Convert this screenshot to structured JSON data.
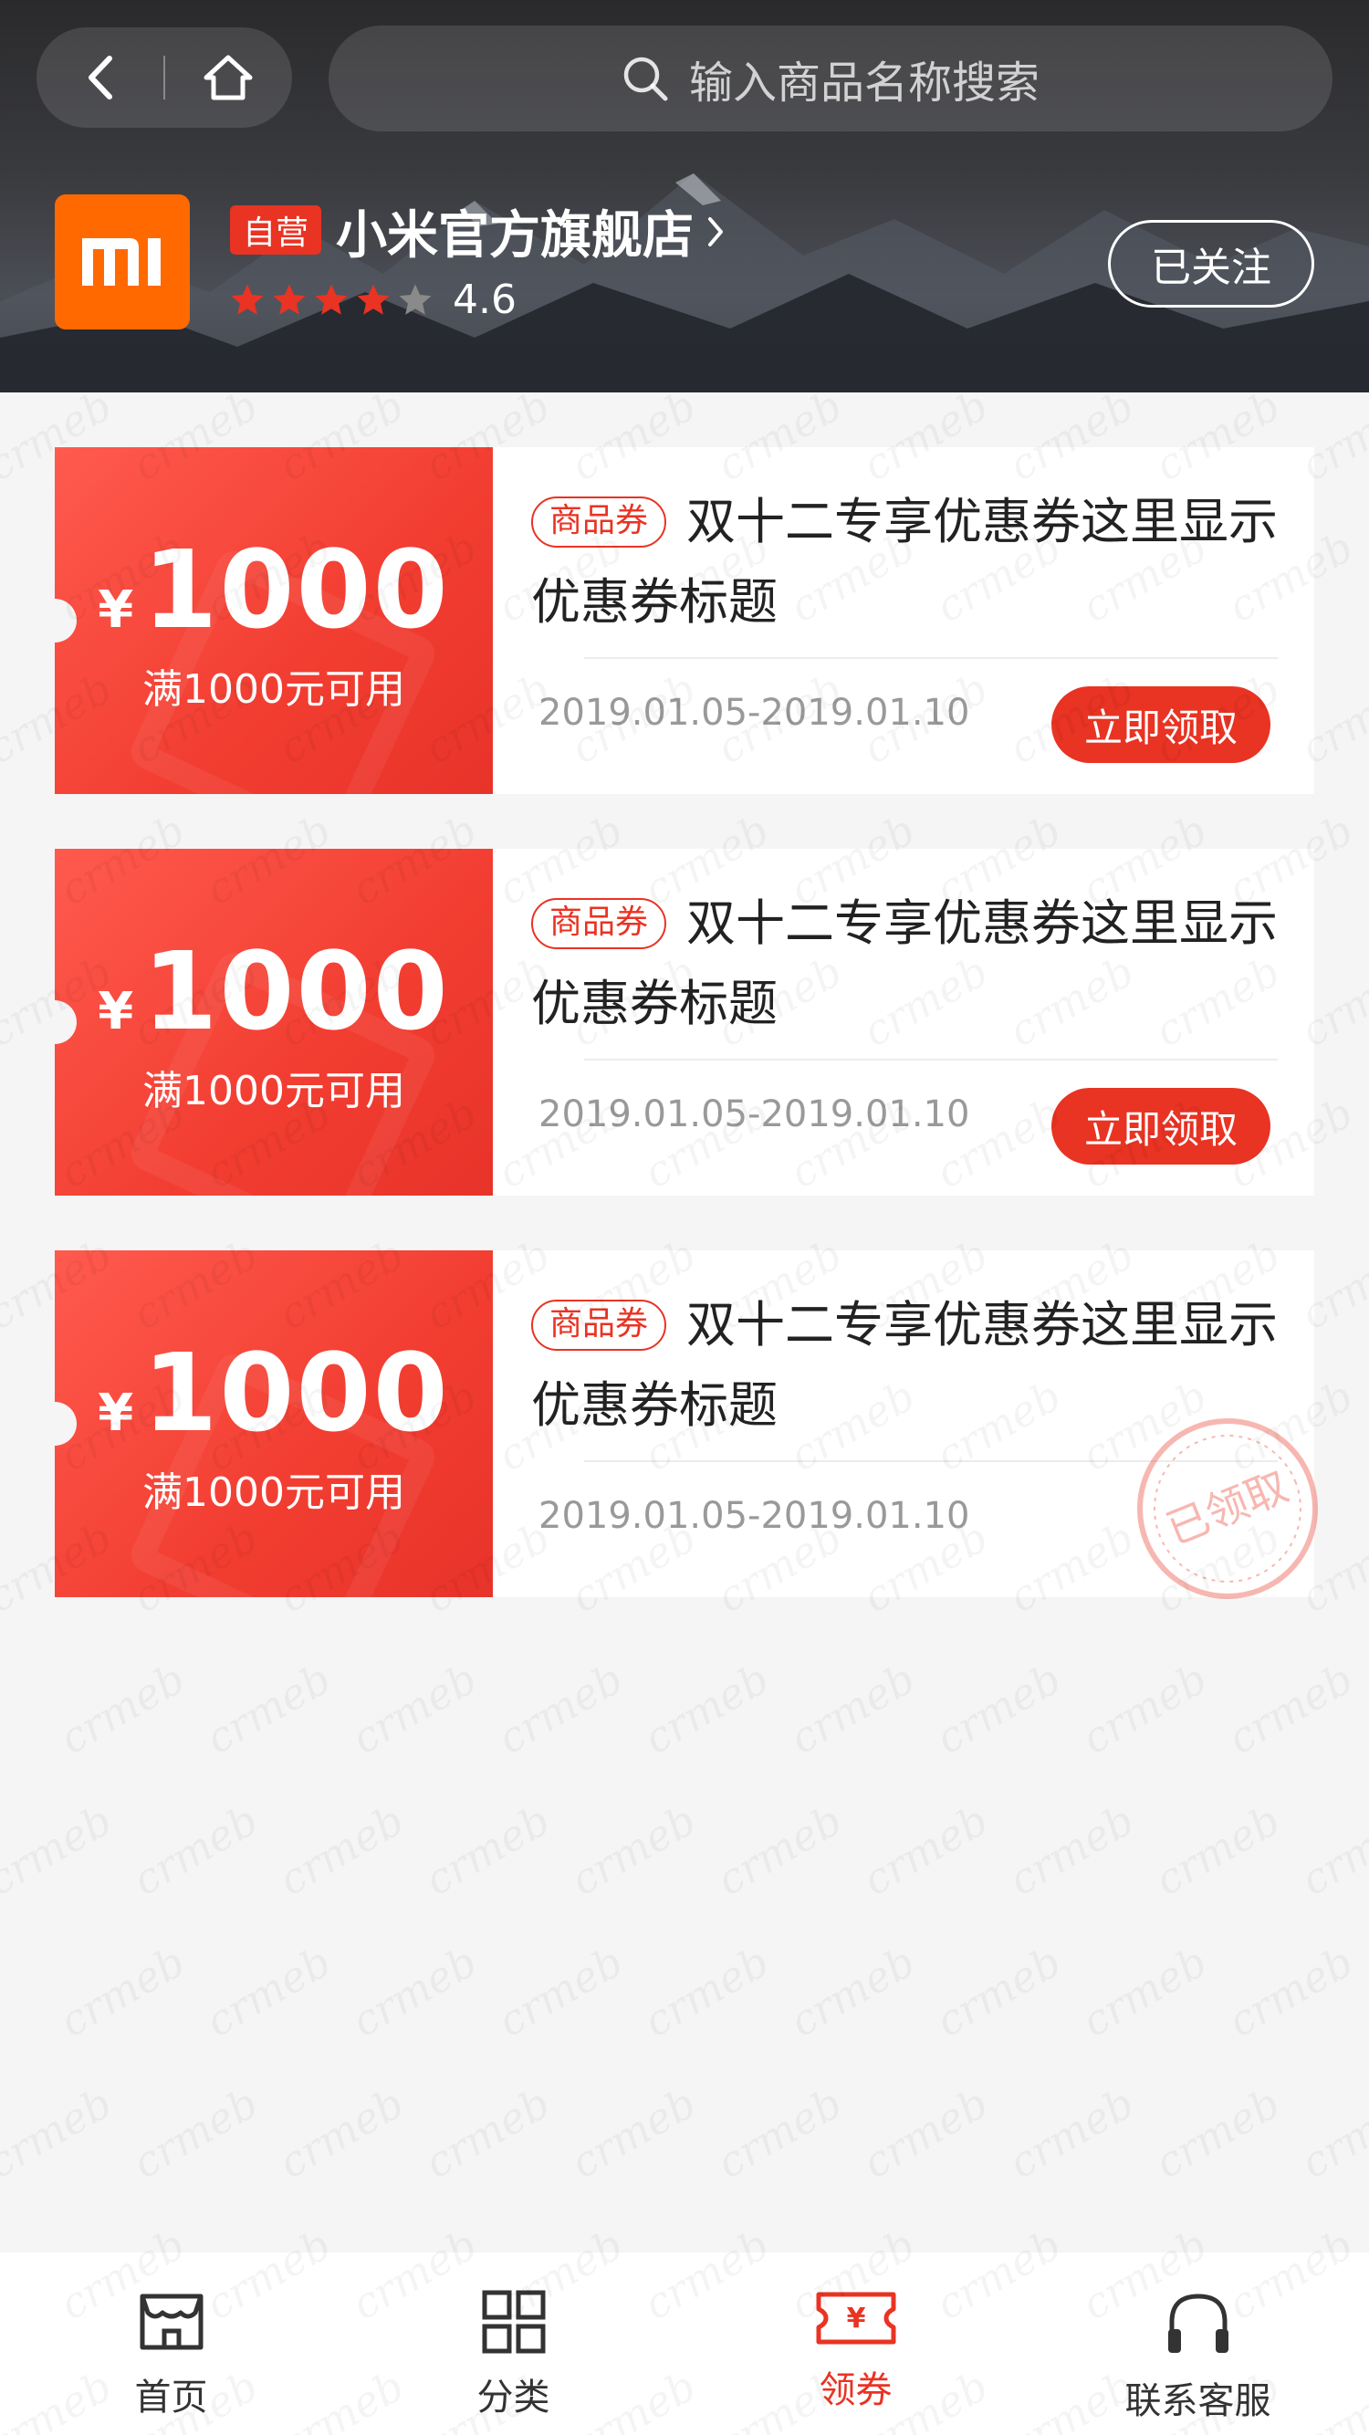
{
  "header": {
    "search_placeholder": "输入商品名称搜索",
    "shop": {
      "logo_text": "mi",
      "self_operated_badge": "自营",
      "name": "小米官方旗舰店",
      "rating": "4.6",
      "rating_stars": 4,
      "follow_label": "已关注"
    }
  },
  "coupons": [
    {
      "currency": "¥",
      "amount": "1000",
      "condition": "满1000元可用",
      "type_tag": "商品券",
      "title": "双十二专享优惠券这里显示优惠券标题",
      "date_range": "2019.01.05-2019.01.10",
      "action_label": "立即领取"
    },
    {
      "currency": "¥",
      "amount": "1000",
      "condition": "满1000元可用",
      "type_tag": "商品券",
      "title": "双十二专享优惠券这里显示优惠券标题",
      "date_range": "2019.01.05-2019.01.10",
      "action_label": "立即领取"
    },
    {
      "currency": "¥",
      "amount": "1000",
      "condition": "满1000元可用",
      "type_tag": "商品券",
      "title": "双十二专享优惠券这里显示优惠券标题",
      "date_range": "2019.01.05-2019.01.10",
      "status_stamp": "已领取"
    }
  ],
  "watermark_text": "crmeb",
  "bottom_nav": [
    {
      "label": "首页",
      "icon": "store-icon",
      "active": false
    },
    {
      "label": "分类",
      "icon": "grid-icon",
      "active": false
    },
    {
      "label": "领券",
      "icon": "coupon-icon",
      "active": true
    },
    {
      "label": "联系客服",
      "icon": "headset-icon",
      "active": false
    }
  ],
  "colors": {
    "accent": "#e93323",
    "brand_orange": "#ff6900",
    "page_bg": "#f5f5f5",
    "star_active": "#e93323",
    "star_inactive": "#8a8a8a"
  }
}
